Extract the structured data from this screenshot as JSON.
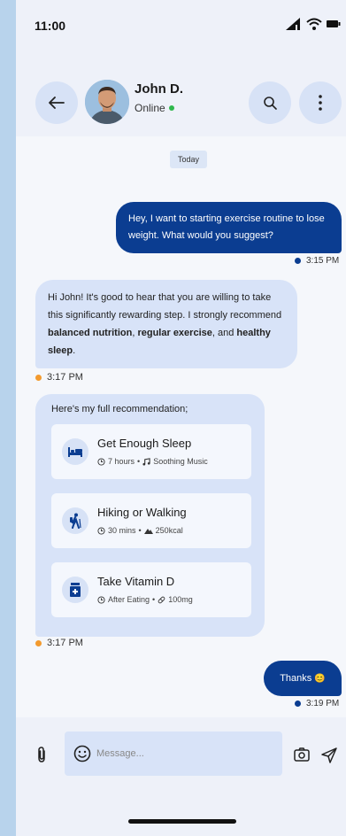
{
  "status_bar": {
    "time": "11:00"
  },
  "header": {
    "back_icon": "arrow-left-icon",
    "contact_name": "John D.",
    "contact_status": "Online",
    "online_color": "#2fb84d",
    "search_icon": "search-icon",
    "menu_icon": "more-vertical-icon"
  },
  "chat": {
    "date_label": "Today",
    "messages": [
      {
        "from": "me",
        "text": "Hey, I want to starting exercise routine to lose weight. What would you suggest?",
        "time": "3:15 PM"
      },
      {
        "from": "them",
        "text_parts": [
          "Hi John! It's good to hear that you are willing to take this significantly rewarding step. I strongly recommend ",
          "balanced nutrition",
          ", ",
          "regular exercise",
          ", and ",
          "healthy sleep",
          "."
        ],
        "time": "3:17 PM"
      },
      {
        "from": "them",
        "title": "Here's my full recommendation;",
        "time": "3:17 PM"
      },
      {
        "from": "me",
        "text": "Thanks",
        "emoji": "😊",
        "time": "3:19 PM"
      }
    ],
    "recommendations": [
      {
        "name": "Get Enough Sleep",
        "icon": "bed-icon",
        "meta_icon_1": "clock-icon",
        "meta_1": "7 hours",
        "meta_icon_2": "music-note-icon",
        "meta_2": "Soothing Music"
      },
      {
        "name": "Hiking or Walking",
        "icon": "hiking-icon",
        "meta_icon_1": "clock-icon",
        "meta_1": "30 mins",
        "meta_icon_2": "mountain-icon",
        "meta_2": "250kcal"
      },
      {
        "name": "Take Vitamin D",
        "icon": "medicine-bottle-icon",
        "meta_icon_1": "clock-icon",
        "meta_1": "After Eating",
        "meta_icon_2": "pill-icon",
        "meta_2": "100mg"
      }
    ]
  },
  "composer": {
    "placeholder": "Message...",
    "attach_icon": "paperclip-icon",
    "emoji_icon": "smiley-icon",
    "camera_icon": "camera-icon",
    "send_icon": "send-icon"
  },
  "colors": {
    "outgoing_bubble": "#0b3d91",
    "incoming_bubble": "#d8e3f8",
    "outgoing_dot": "#0b3d91",
    "incoming_dot": "#f39a2e"
  }
}
